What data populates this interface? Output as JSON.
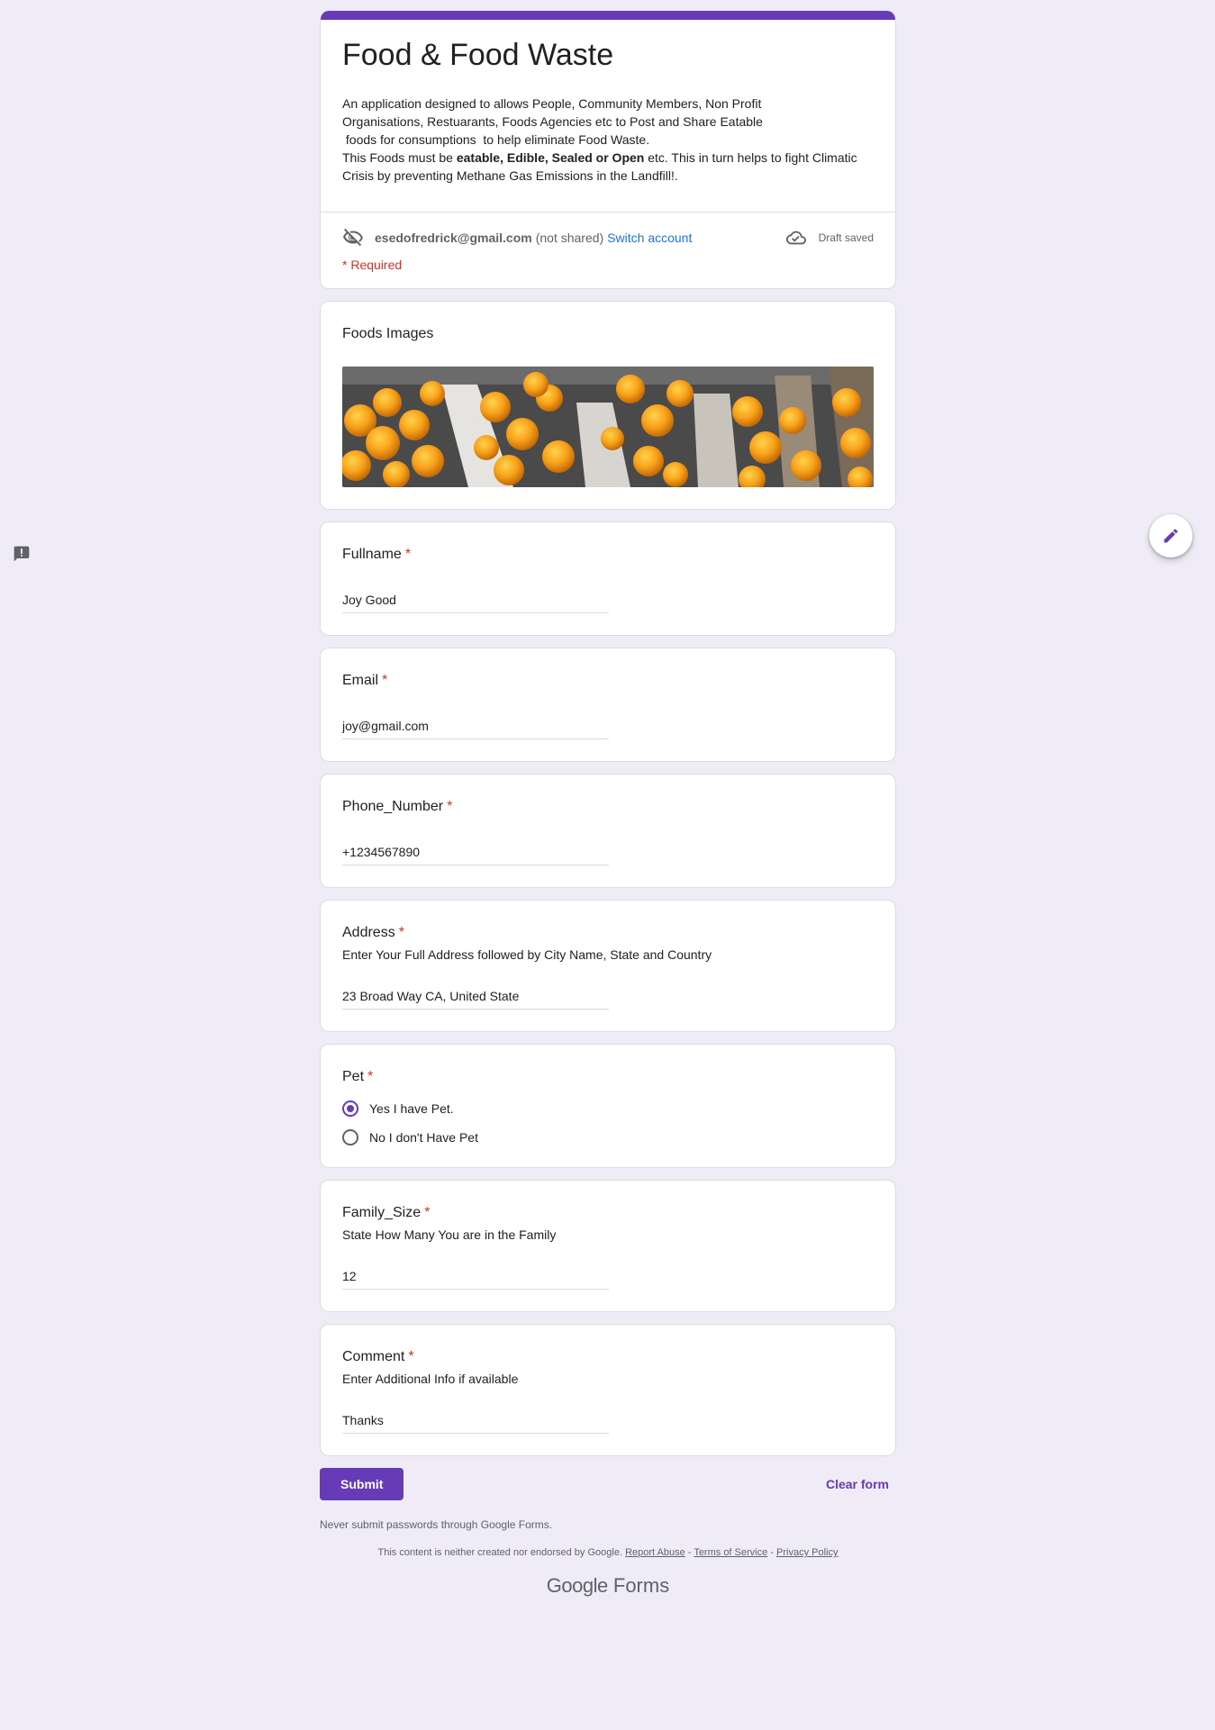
{
  "form": {
    "title": "Food & Food Waste",
    "description_lines": [
      "An application designed to allows People, Community Members, Non Profit",
      "Organisations, Restuarants, Foods Agencies etc to Post and Share Eatable",
      " foods for consumptions  to help eliminate Food Waste.",
      "This Foods must be ",
      "eatable, Edible, Sealed or Open",
      " etc. This in turn helps to fight Climatic Crisis by preventing Methane Gas Emissions in the Landfill!."
    ],
    "account_email": "esedofredrick@gmail.com",
    "account_not_shared": "(not shared)",
    "switch_account": "Switch account",
    "draft_status": "Draft saved",
    "required_note": "* Required"
  },
  "image_question": {
    "title": "Foods Images"
  },
  "questions": [
    {
      "title": "Fullname",
      "star": "*",
      "help": "",
      "value": "Joy Good"
    },
    {
      "title": "Email",
      "star": "*",
      "help": "",
      "value": "joy@gmail.com"
    },
    {
      "title": "Phone_Number",
      "star": "*",
      "help": "",
      "value": "+1234567890"
    },
    {
      "title": "Address",
      "star": "*",
      "help": "Enter Your Full Address followed by City Name, State and Country",
      "value": "23 Broad Way CA, United State"
    }
  ],
  "pet": {
    "title": "Pet",
    "star": "*",
    "options": [
      {
        "label": "Yes I have Pet.",
        "checked": true
      },
      {
        "label": "No I don't Have Pet",
        "checked": false
      }
    ]
  },
  "questions2": [
    {
      "title": "Family_Size",
      "star": "*",
      "help": "State How Many You are in the Family",
      "value": "12"
    },
    {
      "title": "Comment",
      "star": "*",
      "help": "Enter Additional Info if available",
      "value": "Thanks"
    }
  ],
  "actions": {
    "submit": "Submit",
    "clear": "Clear form"
  },
  "footer": {
    "note": "Never submit passwords through Google Forms.",
    "legal": "This content is neither created nor endorsed by Google.",
    "report_abuse": "Report Abuse",
    "terms": "Terms of Service",
    "privacy": "Privacy Policy",
    "sep": " - ",
    "brand_google": "Google",
    "brand_forms": "Forms"
  },
  "colors": {
    "accent": "#673ab7",
    "background": "#efebf7",
    "required": "#d93025",
    "link": "#1a73e8"
  },
  "icons": {
    "not_shared": "eye-off-icon",
    "draft": "cloud-check-icon",
    "feedback": "report-icon",
    "edit": "pencil-icon"
  }
}
